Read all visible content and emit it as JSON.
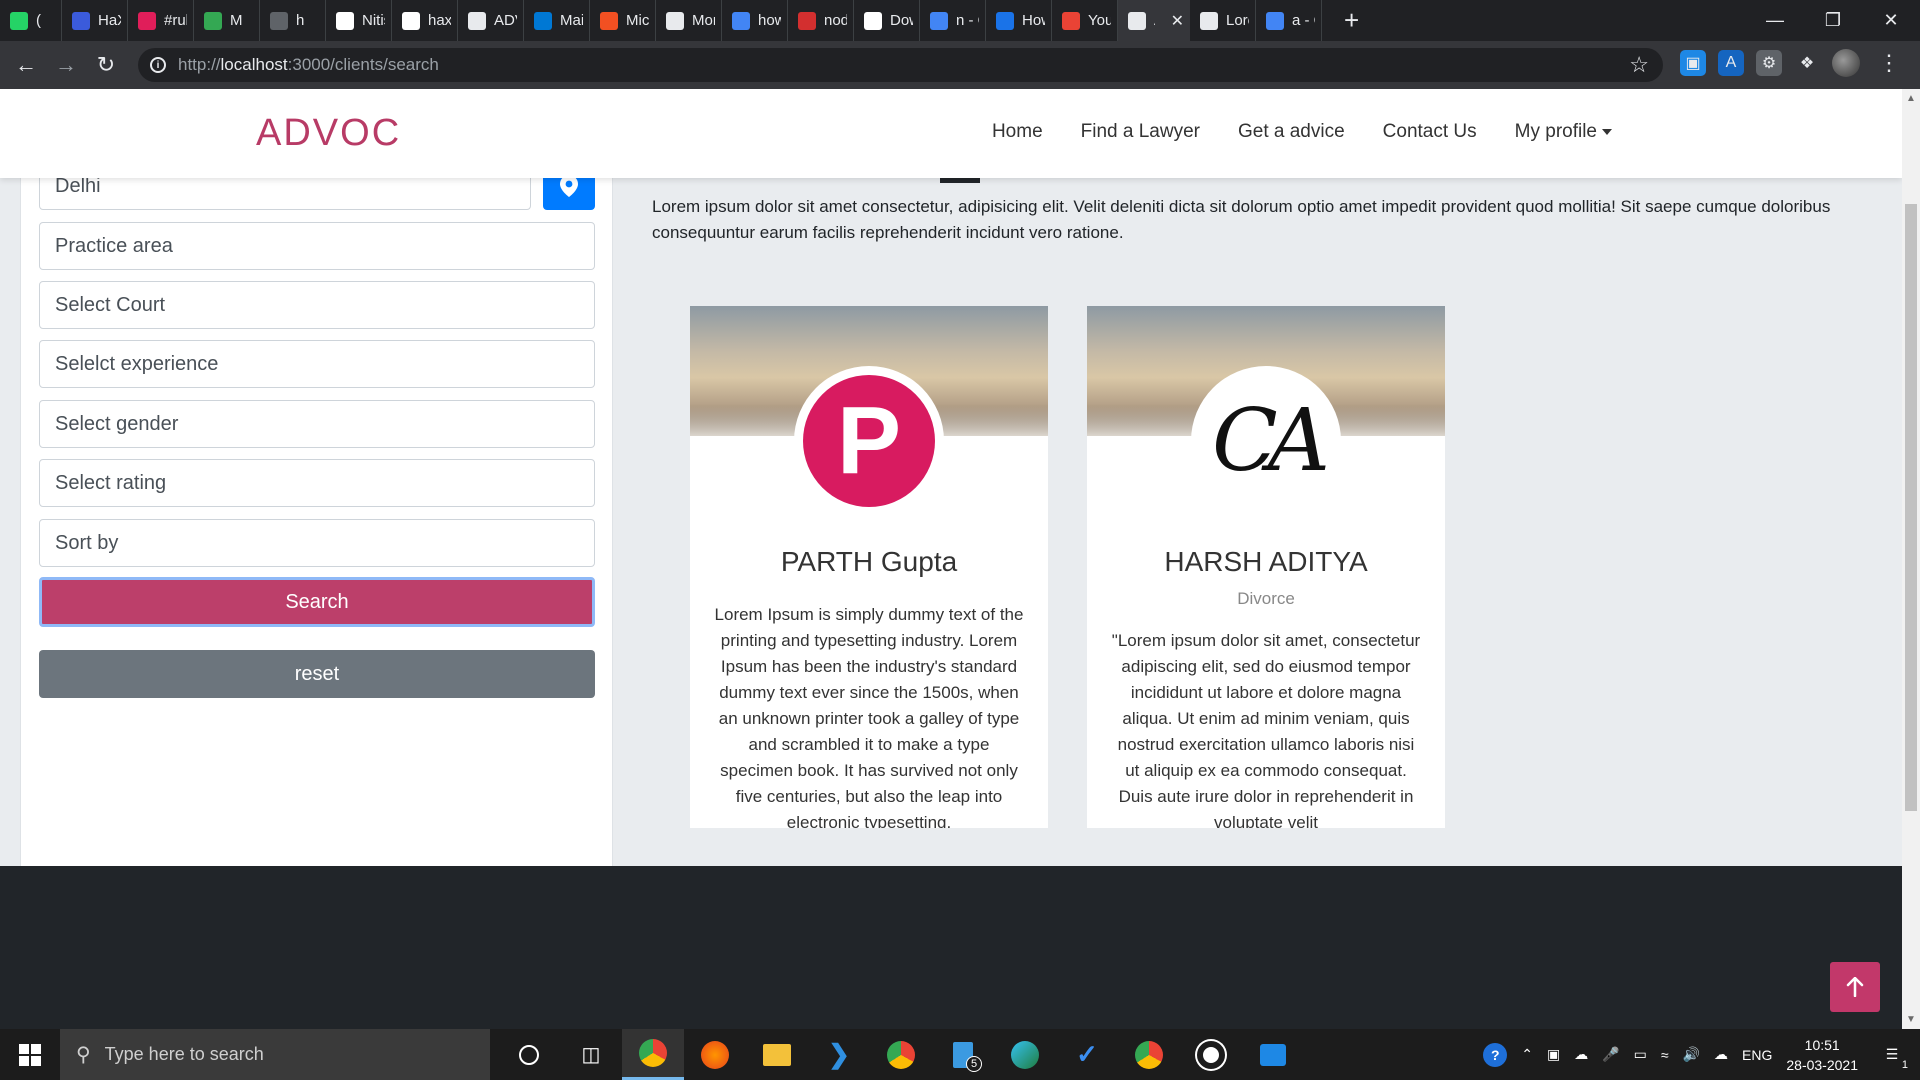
{
  "browser": {
    "tabs": [
      {
        "title": "(",
        "color": "#25d366"
      },
      {
        "title": "HaXp",
        "color": "#3b5bdb"
      },
      {
        "title": "#rule",
        "color": "#e01e5a"
      },
      {
        "title": "M",
        "color": "#34a853"
      },
      {
        "title": "h",
        "color": "#5f6368"
      },
      {
        "title": "Nitis",
        "color": "#ffffff"
      },
      {
        "title": "haxp",
        "color": "#ffffff"
      },
      {
        "title": "ADV",
        "color": "#e8eaed"
      },
      {
        "title": "Mail",
        "color": "#0078d4"
      },
      {
        "title": "Micr",
        "color": "#f25022"
      },
      {
        "title": "Mon",
        "color": "#e8eaed"
      },
      {
        "title": "how",
        "color": "#4285f4"
      },
      {
        "title": "node",
        "color": "#d32f2f"
      },
      {
        "title": "Dow",
        "color": "#ffffff"
      },
      {
        "title": "n - G",
        "color": "#4285f4"
      },
      {
        "title": "How",
        "color": "#1a73e8"
      },
      {
        "title": "Your",
        "color": "#ea4335"
      },
      {
        "title": "A",
        "color": "#e8eaed",
        "active": true
      },
      {
        "title": "Lore",
        "color": "#e8eaed"
      },
      {
        "title": "a - G",
        "color": "#4285f4"
      }
    ],
    "new_tab": "+",
    "url_host": "localhost",
    "url_prefix": "http://",
    "url_path": ":3000/clients/search"
  },
  "navbar": {
    "brand": "ADVOC",
    "links": [
      "Home",
      "Find a Lawyer",
      "Get a advice",
      "Contact Us"
    ],
    "profile": "My profile"
  },
  "filters": {
    "location_value": "Delhi",
    "practice_area": "Practice area",
    "court": "Select Court",
    "experience": "Selelct experience",
    "gender": "Select gender",
    "rating": "Select rating",
    "sort": "Sort by",
    "search_label": "Search",
    "reset_label": "reset"
  },
  "content": {
    "intro": "Lorem ipsum dolor sit amet consectetur, adipisicing elit. Velit deleniti dicta sit dolorum optio amet impedit provident quod mollitia! Sit saepe cumque doloribus consequuntur earum facilis reprehenderit incidunt vero ratione.",
    "lawyers": [
      {
        "name": "PARTH Gupta",
        "specialty": "",
        "avatar_letter": "P",
        "bio": "Lorem Ipsum is simply dummy text of the printing and typesetting industry. Lorem Ipsum has been the industry's standard dummy text ever since the 1500s, when an unknown printer took a galley of type and scrambled it to make a type specimen book. It has survived not only five centuries, but also the leap into electronic typesetting."
      },
      {
        "name": "HARSH ADITYA",
        "specialty": "Divorce",
        "avatar_letter": "CA",
        "bio": "\"Lorem ipsum dolor sit amet, consectetur adipiscing elit, sed do eiusmod tempor incididunt ut labore et dolore magna aliqua. Ut enim ad minim veniam, quis nostrud exercitation ullamco laboris nisi ut aliquip ex ea commodo consequat. Duis aute irure dolor in reprehenderit in voluptate velit"
      }
    ]
  },
  "taskbar": {
    "search_placeholder": "Type here to search",
    "language": "ENG",
    "time": "10:51",
    "date": "28-03-2021",
    "notification_count": "1",
    "badge_count": "5"
  },
  "colors": {
    "brand": "#b83b66",
    "search_button": "#bc3f6a",
    "reset_button": "#6c757d",
    "location_button": "#007bff",
    "avatar_p": "#d81b60",
    "footer": "#212529",
    "back_to_top": "#c2386a"
  }
}
